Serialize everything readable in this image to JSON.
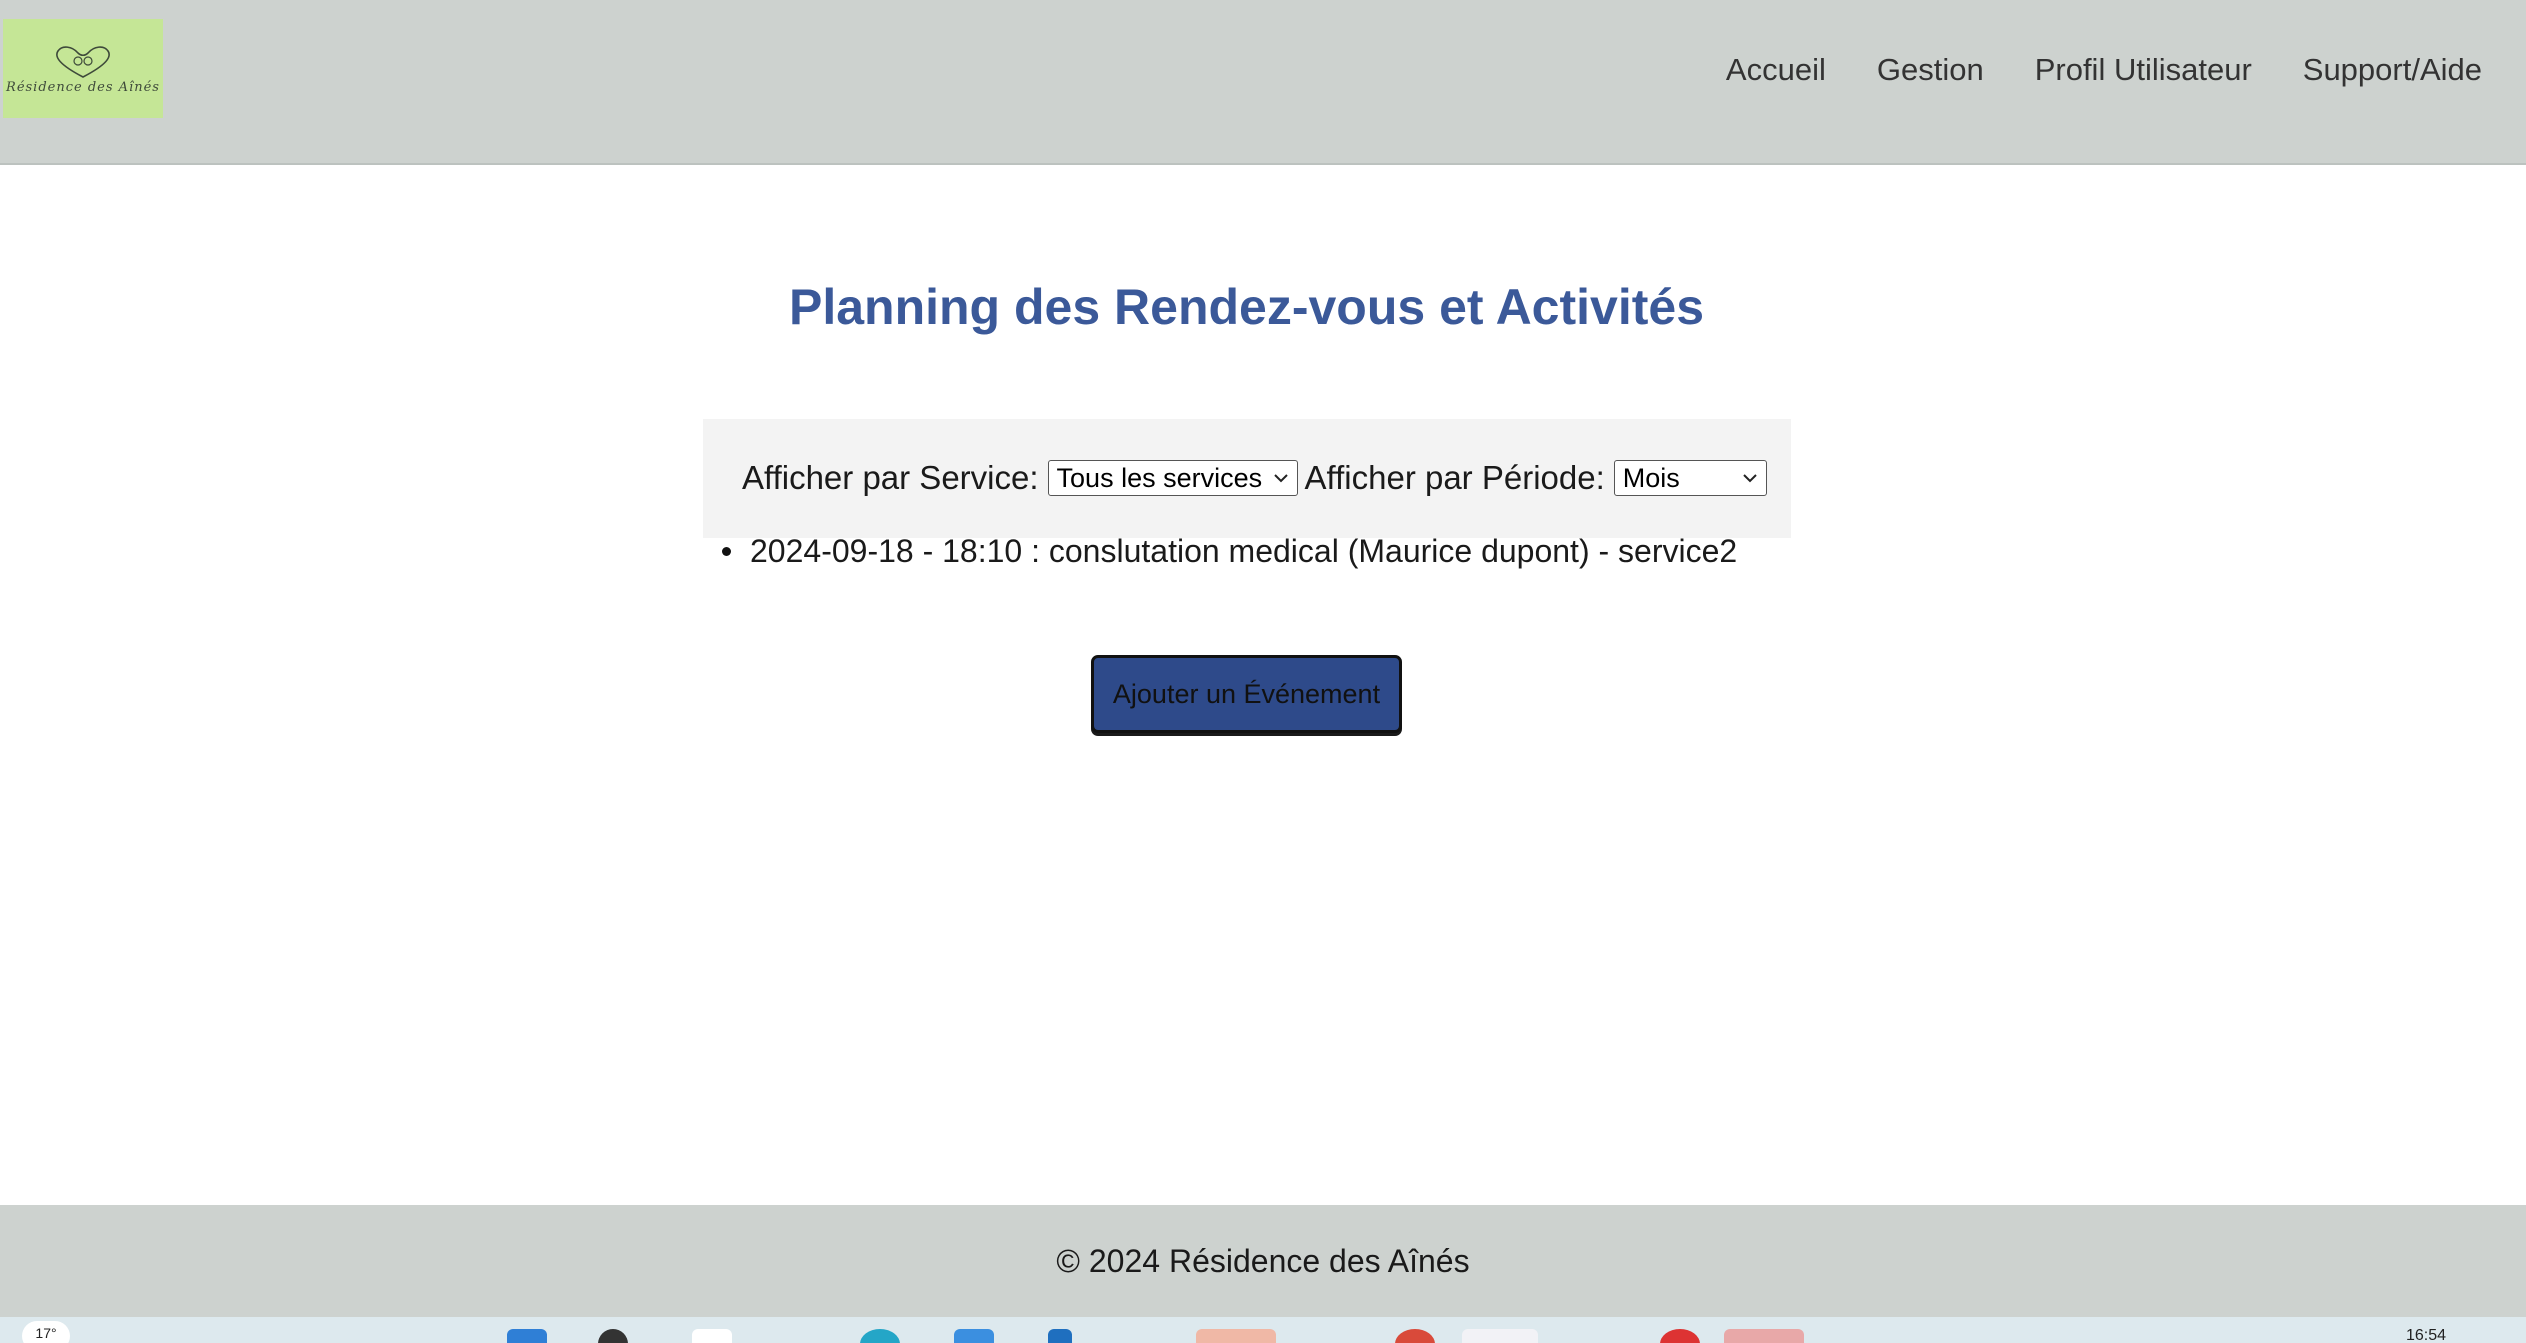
{
  "header": {
    "logo_text": "Résidence des Aînés",
    "nav": [
      "Accueil",
      "Gestion",
      "Profil Utilisateur",
      "Support/Aide"
    ]
  },
  "main": {
    "title": "Planning des Rendez-vous et Activités",
    "filters": {
      "service_label": "Afficher par Service:",
      "service_value": "Tous les services",
      "periode_label": "Afficher par Période:",
      "periode_value": "Mois"
    },
    "events": [
      "2024-09-18 - 18:10 : conslutation medical (Maurice dupont) - service2"
    ],
    "add_button": "Ajouter un Événement"
  },
  "footer": {
    "text": "© 2024 Résidence des Aînés"
  },
  "taskbar": {
    "weather": "17°",
    "clock": "16:54"
  },
  "colors": {
    "header_bg": "#cdd2cf",
    "title": "#3b5999",
    "button_bg": "#2e4a8a",
    "logo_bg": "#c5e696"
  }
}
